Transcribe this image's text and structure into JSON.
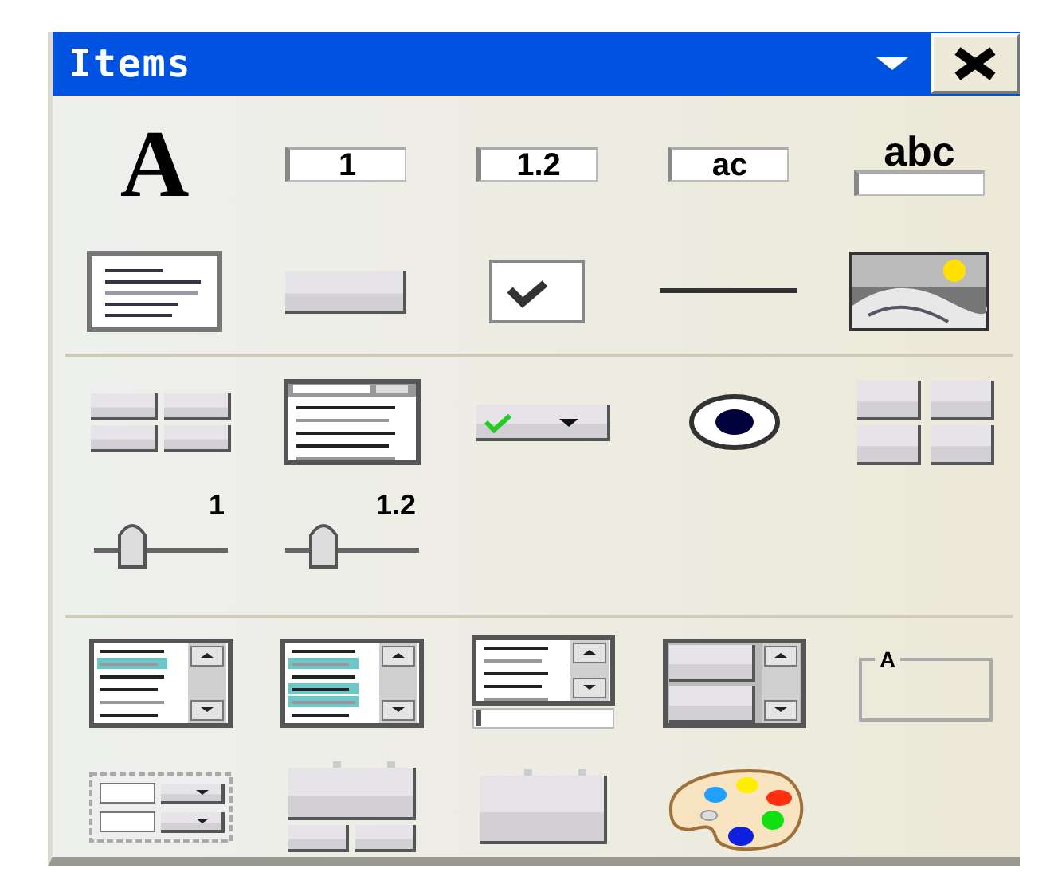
{
  "window": {
    "title": "Items"
  },
  "sections": [
    {
      "rows": [
        [
          {
            "kind": "glyph",
            "label": "A"
          },
          {
            "kind": "field",
            "label": "1"
          },
          {
            "kind": "field",
            "label": "1.2"
          },
          {
            "kind": "field",
            "label": "ac"
          },
          {
            "kind": "labeled-field",
            "label": "abc"
          }
        ],
        [
          {
            "kind": "text-area"
          },
          {
            "kind": "button"
          },
          {
            "kind": "checkbox"
          },
          {
            "kind": "line"
          },
          {
            "kind": "image"
          }
        ]
      ]
    },
    {
      "rows": [
        [
          {
            "kind": "matrix"
          },
          {
            "kind": "text-window"
          },
          {
            "kind": "option-menu"
          },
          {
            "kind": "radio"
          },
          {
            "kind": "square-matrix"
          }
        ],
        [
          {
            "kind": "slider",
            "label": "1"
          },
          {
            "kind": "slider",
            "label": "1.2"
          }
        ]
      ]
    },
    {
      "rows": [
        [
          {
            "kind": "list"
          },
          {
            "kind": "list-multi"
          },
          {
            "kind": "list-field"
          },
          {
            "kind": "button-list"
          },
          {
            "kind": "group-box",
            "label": "A"
          }
        ],
        [
          {
            "kind": "field-group"
          },
          {
            "kind": "tabs-buttons"
          },
          {
            "kind": "tabs"
          },
          {
            "kind": "palette"
          }
        ]
      ]
    }
  ]
}
